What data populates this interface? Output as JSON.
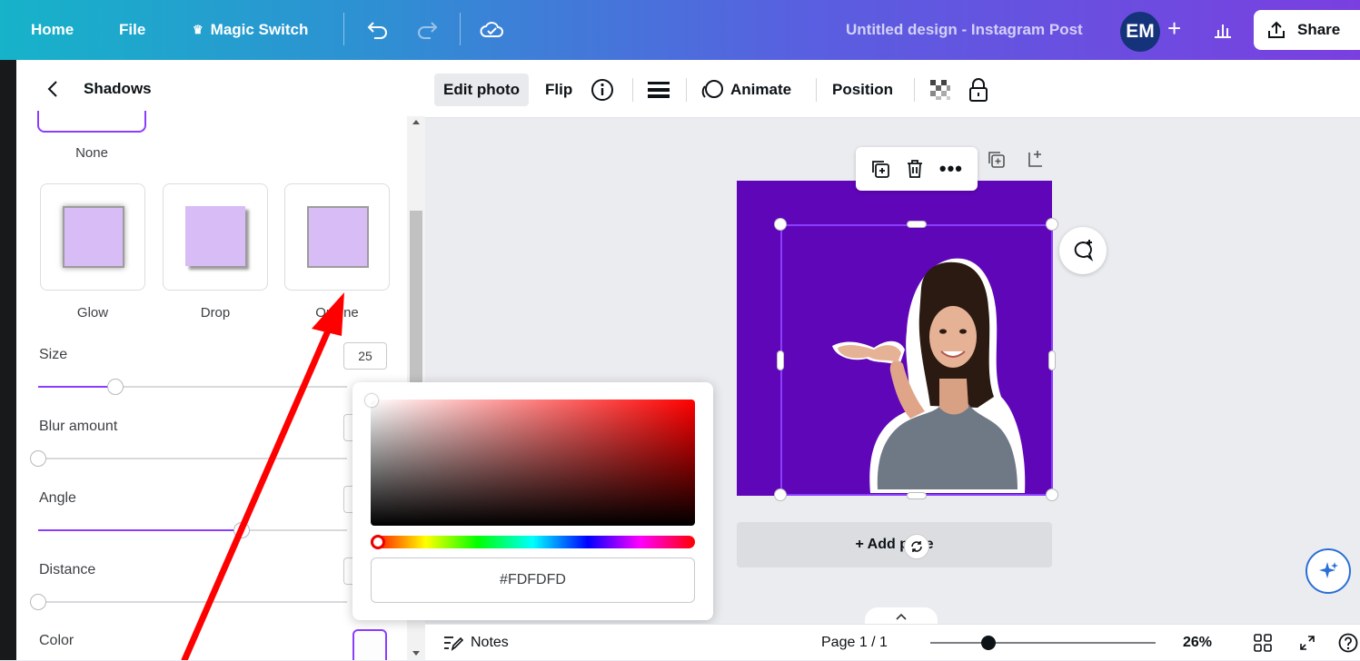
{
  "topbar": {
    "home": "Home",
    "file": "File",
    "magic_switch": "Magic Switch",
    "doc_title": "Untitled design - Instagram Post",
    "avatar": "EM",
    "plus": "+",
    "share": "Share"
  },
  "panel": {
    "title": "Shadows",
    "effects": {
      "none": "None",
      "glow": "Glow",
      "drop": "Drop",
      "outline": "Outline"
    },
    "controls": {
      "size_label": "Size",
      "size_value": "25",
      "size_level_pct": 25,
      "blur_label": "Blur amount",
      "blur_level_pct": 0,
      "angle_label": "Angle",
      "angle_level_pct": 66,
      "distance_label": "Distance",
      "distance_level_pct": 0,
      "color_label": "Color"
    }
  },
  "toolbar": {
    "edit_photo": "Edit photo",
    "flip": "Flip",
    "animate": "Animate",
    "position": "Position"
  },
  "canvas": {
    "page_color": "#5f06b8",
    "add_page": "+ Add page"
  },
  "color_picker": {
    "hex_value": "#FDFDFD"
  },
  "footer": {
    "notes": "Notes",
    "page_indicator": "Page 1 / 1",
    "zoom": "26%",
    "zoom_level_pct": 26
  },
  "colors": {
    "accent": "#8b3dff",
    "annotation_arrow": "#ff0000"
  }
}
